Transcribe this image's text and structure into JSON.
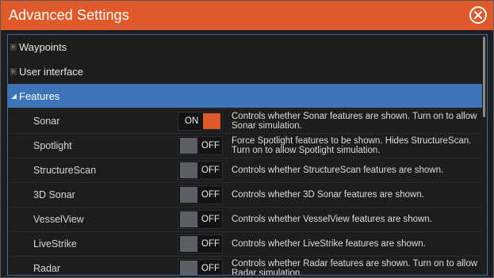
{
  "dialog": {
    "title": "Advanced Settings"
  },
  "colors": {
    "titlebar": "#e0592a",
    "selected_row": "#3d74b8",
    "toggle_on": "#e0592a",
    "toggle_off": "#5c5f65"
  },
  "tree": [
    {
      "label": "Waypoints",
      "state": "collapsed"
    },
    {
      "label": "User interface",
      "state": "collapsed"
    },
    {
      "label": "Features",
      "state": "expanded"
    }
  ],
  "features": [
    {
      "name": "Sonar",
      "toggle": "ON",
      "description": "Controls whether Sonar features are shown. Turn on to allow Sonar simulation."
    },
    {
      "name": "Spotlight",
      "toggle": "OFF",
      "description": "Force Spotlight features to be shown. Hides StructureScan. Turn on to allow Spotlight simulation."
    },
    {
      "name": "StructureScan",
      "toggle": "OFF",
      "description": "Controls whether StructureScan features are shown."
    },
    {
      "name": "3D Sonar",
      "toggle": "OFF",
      "description": "Controls whether 3D Sonar features are shown."
    },
    {
      "name": "VesselView",
      "toggle": "OFF",
      "description": "Controls whether VesselView features are shown."
    },
    {
      "name": "LiveStrike",
      "toggle": "OFF",
      "description": "Controls whether LiveStrike features are shown."
    },
    {
      "name": "Radar",
      "toggle": "OFF",
      "description": "Controls whether Radar features are shown. Turn on to allow Radar simulation."
    }
  ]
}
